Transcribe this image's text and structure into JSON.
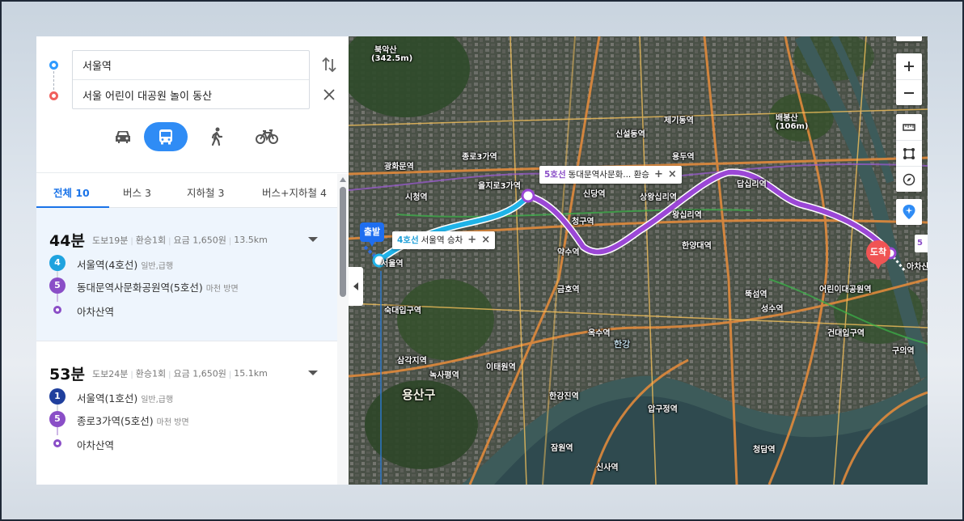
{
  "search": {
    "origin": "서울역",
    "destination": "서울 어린이 대공원 놀이 동산"
  },
  "modes": [
    {
      "icon": "car-icon",
      "active": false
    },
    {
      "icon": "bus-icon",
      "active": true
    },
    {
      "icon": "walk-icon",
      "active": false
    },
    {
      "icon": "bicycle-icon",
      "active": false
    }
  ],
  "tabs": [
    {
      "label": "전체 10",
      "active": true
    },
    {
      "label": "버스 3"
    },
    {
      "label": "지하철 3"
    },
    {
      "label": "버스+지하철 4"
    }
  ],
  "routes": [
    {
      "time": "44분",
      "walk": "도보19분",
      "transfer": "환승1회",
      "fare": "요금 1,650원",
      "distance": "13.5km",
      "steps": [
        {
          "badge": "4",
          "color": "#1fa3df",
          "name": "서울역(4호선)",
          "sub": "일반,급행"
        },
        {
          "badge": "5",
          "color": "#8a4ec7",
          "name": "동대문역사문화공원역(5호선)",
          "sub": "마천 방면"
        },
        {
          "badge": "",
          "color": "#8a4ec7",
          "name": "아차산역",
          "sub": ""
        }
      ]
    },
    {
      "time": "53분",
      "walk": "도보24분",
      "transfer": "환승1회",
      "fare": "요금 1,650원",
      "distance": "15.1km",
      "steps": [
        {
          "badge": "1",
          "color": "#1f3f9d",
          "name": "서울역(1호선)",
          "sub": "일반,급행"
        },
        {
          "badge": "5",
          "color": "#8a4ec7",
          "name": "종로3가역(5호선)",
          "sub": "마천 방면"
        },
        {
          "badge": "",
          "color": "#8a4ec7",
          "name": "아차산역",
          "sub": ""
        }
      ]
    }
  ],
  "map": {
    "start_pin": "출발",
    "end_pin": "도착",
    "edge_tag": "5",
    "callout_boarding": {
      "line": "4호선",
      "text": "서울역 승차"
    },
    "callout_transfer": {
      "line": "5호선",
      "text": "동대문역사문화... 환승"
    },
    "labels": {
      "seoul_station": "서울역",
      "sookdae": "숙대입구역",
      "samgakji": "삼각지역",
      "yongsan": "용산구",
      "noksapyeong": "녹사평역",
      "itaewon": "이태원역",
      "hangangjin": "한강진역",
      "oksu": "옥수역",
      "geumho": "금호역",
      "yaksu": "약수역",
      "sindang": "신당역",
      "cheonggu": "청구역",
      "sangwangsimni": "상왕십리역",
      "wangsimni": "왕십리역",
      "hanyang": "한양대역",
      "ttukseom": "뚝섬역",
      "seongsu": "성수역",
      "konkuk": "건대입구역",
      "guui": "구의역",
      "childpark": "어린이대공원역",
      "achasan": "아차산역",
      "euljiro3": "을지로3가역",
      "jongno3": "종로3가역",
      "sicheong": "시청역",
      "gwanghwamun": "광화문역",
      "dapsimni": "답십리역",
      "yongdu": "용두역",
      "jegi": "제기동역",
      "sinseol": "신설동역",
      "apgujeong": "압구정역",
      "cheongdam": "청담역",
      "sinsa": "신사역",
      "jamwon": "잠원역",
      "hangang": "한강",
      "bukaksan": "북악산",
      "bukaksan_h": "(342.5m)",
      "baebongsan": "배봉산",
      "baebongsan_h": "(106m)"
    }
  }
}
